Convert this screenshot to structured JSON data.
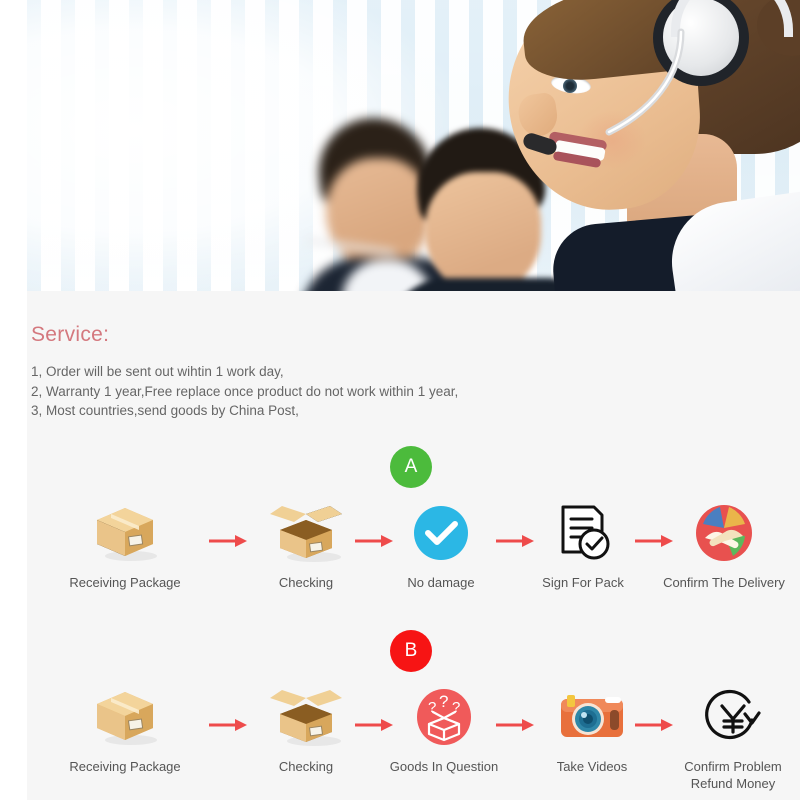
{
  "hero": {
    "alt": "call-center-agents-photo",
    "description": "Smiling woman wearing a white headset in the foreground with two blurred male colleagues behind her in a bright office"
  },
  "service": {
    "title": "Service:",
    "lines": [
      "1,  Order will be sent out wihtin 1 work day,",
      "2,  Warranty 1 year,Free replace once product do not work within 1 year,",
      "3,  Most countries,send goods by China Post,"
    ]
  },
  "colors": {
    "badge_a": "#4cbb3c",
    "badge_b": "#f71414",
    "arrow": "#ee4b4b",
    "title": "#d4787e",
    "body_text": "#666666",
    "background": "#f6f6f6"
  },
  "flows": [
    {
      "badge": "A",
      "badge_color": "#4cbb3c",
      "steps": [
        {
          "label": "Receiving Package",
          "icon": "closed-box-icon"
        },
        {
          "label": "Checking",
          "icon": "open-box-icon"
        },
        {
          "label": "No damage",
          "icon": "blue-check-circle-icon"
        },
        {
          "label": "Sign For Pack",
          "icon": "signed-document-icon"
        },
        {
          "label": "Confirm The Delivery",
          "icon": "handshake-circle-icon"
        }
      ]
    },
    {
      "badge": "B",
      "badge_color": "#f71414",
      "steps": [
        {
          "label": "Receiving Package",
          "icon": "closed-box-icon"
        },
        {
          "label": "Checking",
          "icon": "open-box-icon"
        },
        {
          "label": "Goods In Question",
          "icon": "question-box-circle-icon"
        },
        {
          "label": "Take Videos",
          "icon": "camera-icon"
        },
        {
          "label": "Confirm Problem\nRefund Money",
          "icon": "yen-refund-icon"
        }
      ]
    }
  ]
}
